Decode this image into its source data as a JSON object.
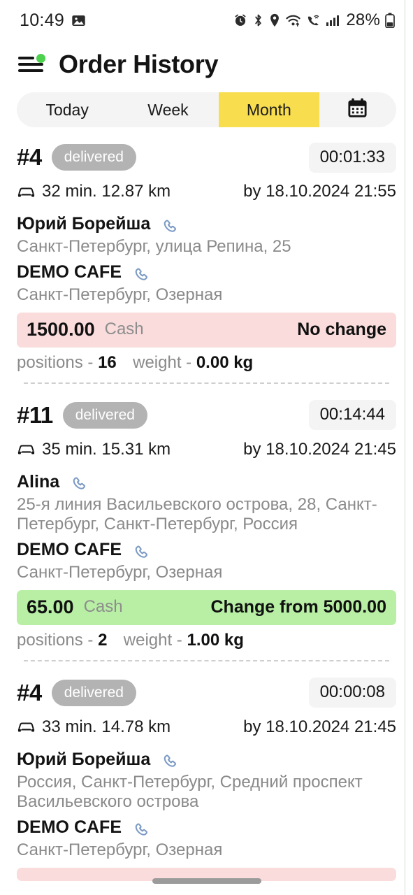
{
  "status_bar": {
    "time": "10:49",
    "battery_percent": "28%",
    "icons": [
      "image-icon",
      "alarm-icon",
      "bluetooth-icon",
      "location-icon",
      "wifi-icon",
      "call-wifi-icon",
      "signal-icon",
      "battery-icon"
    ]
  },
  "header": {
    "title": "Order History",
    "menu_icon": "hamburger-menu-icon",
    "badge_color": "#4ed14e"
  },
  "tabs": {
    "items": [
      {
        "label": "Today",
        "active": false
      },
      {
        "label": "Week",
        "active": false
      },
      {
        "label": "Month",
        "active": true
      }
    ],
    "calendar_icon": "calendar-icon",
    "active_color": "#f8dd4e"
  },
  "orders": [
    {
      "number": "#4",
      "status": "delivered",
      "timer": "00:01:33",
      "trip": "32 min. 12.87 km",
      "due": "by 18.10.2024 21:55",
      "customer_name": "Юрий Борейша",
      "customer_address": "Санкт-Петербург, улица Репина, 25",
      "shop_name": "DEMO CAFE",
      "shop_address": "Санкт-Петербург, Озерная",
      "pay_amount": "1500.00",
      "pay_method": "Cash",
      "pay_change": "No change",
      "pay_tone": "pink",
      "positions_label": "positions -",
      "positions_value": "16",
      "weight_label": "weight -",
      "weight_value": "0.00 kg"
    },
    {
      "number": "#11",
      "status": "delivered",
      "timer": "00:14:44",
      "trip": "35 min. 15.31 km",
      "due": "by 18.10.2024 21:45",
      "customer_name": "Alina",
      "customer_address": "25-я линия Васильевского острова, 28, Санкт-Петербург, Санкт-Петербург, Россия",
      "shop_name": "DEMO CAFE",
      "shop_address": "Санкт-Петербург, Озерная",
      "pay_amount": "65.00",
      "pay_method": "Cash",
      "pay_change": "Change from 5000.00",
      "pay_tone": "green",
      "positions_label": "positions -",
      "positions_value": "2",
      "weight_label": "weight -",
      "weight_value": "1.00 kg"
    },
    {
      "number": "#4",
      "status": "delivered",
      "timer": "00:00:08",
      "trip": "33 min. 14.78 km",
      "due": "by 18.10.2024 21:45",
      "customer_name": "Юрий Борейша",
      "customer_address": "Россия, Санкт-Петербург, Средний проспект Васильевского острова",
      "shop_name": "DEMO CAFE",
      "shop_address": "Санкт-Петербург, Озерная",
      "pay_amount": "",
      "pay_method": "",
      "pay_change": "",
      "pay_tone": "pink",
      "positions_label": "",
      "positions_value": "",
      "weight_label": "",
      "weight_value": ""
    }
  ],
  "colors": {
    "accent_yellow": "#f8dd4e",
    "badge_gray": "#b3b3b3",
    "pay_pink": "#fadcdc",
    "pay_green": "#b8efa5",
    "phone_icon_blue": "#7b9ac4"
  }
}
